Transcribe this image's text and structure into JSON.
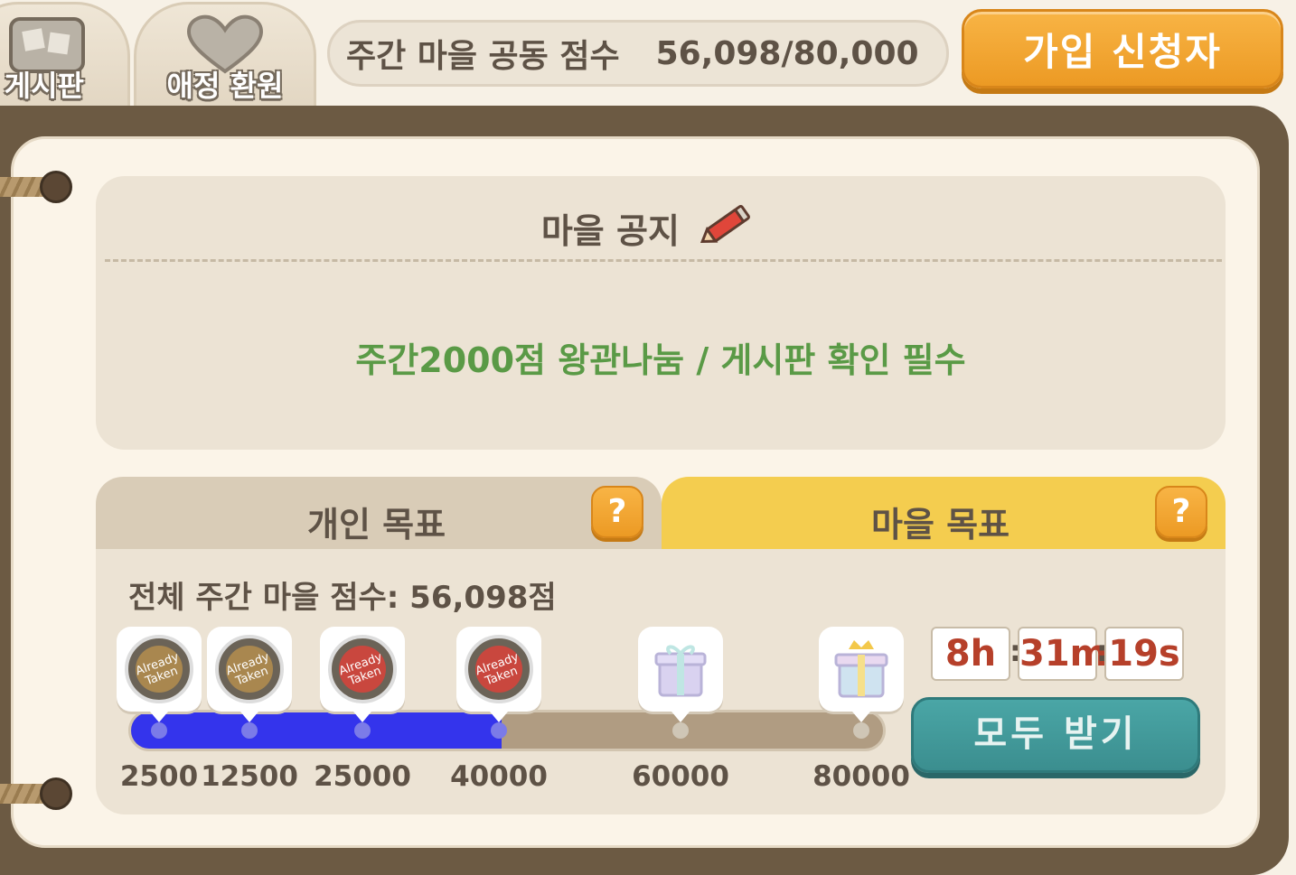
{
  "top_tabs": {
    "board_label": "게시판",
    "affection_label": "애정 환원"
  },
  "weekly_score": {
    "label": "주간 마을 공동 점수",
    "value": "56,098/80,000"
  },
  "applicants_button_label": "가입 신청자",
  "notice": {
    "title": "마을 공지",
    "text": "주간2000점 왕관나눔 / 게시판 확인 필수"
  },
  "goal_tabs": {
    "personal_label": "개인 목표",
    "village_label": "마을 목표",
    "active": "village",
    "help_label": "?"
  },
  "village_goal": {
    "total_score_label": "전체 주간 마을 점수: 56,098점",
    "current_score": 56098,
    "max_score": 80000,
    "milestones": [
      {
        "label": "2500",
        "status": "Already Taken"
      },
      {
        "label": "12500",
        "status": "Already Taken"
      },
      {
        "label": "25000",
        "status": "Already Taken"
      },
      {
        "label": "40000",
        "status": "Already Taken"
      },
      {
        "label": "60000",
        "status": "locked"
      },
      {
        "label": "80000",
        "status": "locked"
      }
    ],
    "timer": {
      "hours": "8h",
      "minutes": "31m",
      "seconds": "19s"
    },
    "claim_all_label": "모두 받기"
  },
  "colors": {
    "progress_fill": "#3434ec",
    "accent_orange": "#f0a22e",
    "village_tab": "#f4cd4f",
    "notice_text": "#5a9a46",
    "claim_button": "#3f9596"
  },
  "icons": {
    "board": "bulletin-board-icon",
    "affection": "heart-icon",
    "edit": "pencil-icon",
    "reward_taken": "already-taken-medal-icon",
    "reward_gift": "gift-box-icon",
    "reward_crown_gift": "crown-gift-icon"
  }
}
